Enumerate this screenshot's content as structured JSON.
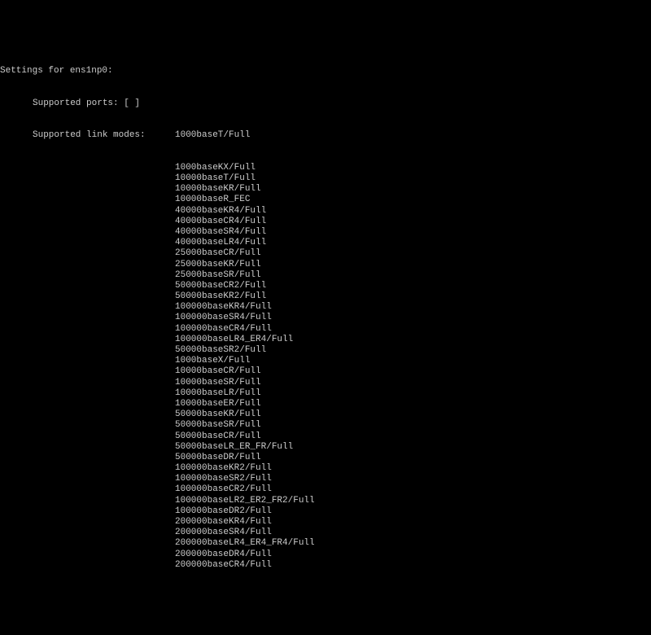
{
  "header": {
    "settings_line": "Settings for ens1np0:",
    "supported_ports_label": "Supported ports: [ ]",
    "supported_link_modes_label": "Supported link modes:"
  },
  "link_modes": [
    "1000baseT/Full",
    "1000baseKX/Full",
    "10000baseT/Full",
    "10000baseKR/Full",
    "10000baseR_FEC",
    "40000baseKR4/Full",
    "40000baseCR4/Full",
    "40000baseSR4/Full",
    "40000baseLR4/Full",
    "25000baseCR/Full",
    "25000baseKR/Full",
    "25000baseSR/Full",
    "50000baseCR2/Full",
    "50000baseKR2/Full",
    "100000baseKR4/Full",
    "100000baseSR4/Full",
    "100000baseCR4/Full",
    "100000baseLR4_ER4/Full",
    "50000baseSR2/Full",
    "1000baseX/Full",
    "10000baseCR/Full",
    "10000baseSR/Full",
    "10000baseLR/Full",
    "10000baseER/Full",
    "50000baseKR/Full",
    "50000baseSR/Full",
    "50000baseCR/Full",
    "50000baseLR_ER_FR/Full",
    "50000baseDR/Full",
    "100000baseKR2/Full",
    "100000baseSR2/Full",
    "100000baseCR2/Full",
    "100000baseLR2_ER2_FR2/Full",
    "100000baseDR2/Full",
    "200000baseKR4/Full",
    "200000baseSR4/Full",
    "200000baseLR4_ER4_FR4/Full",
    "200000baseDR4/Full",
    "200000baseCR4/Full"
  ]
}
